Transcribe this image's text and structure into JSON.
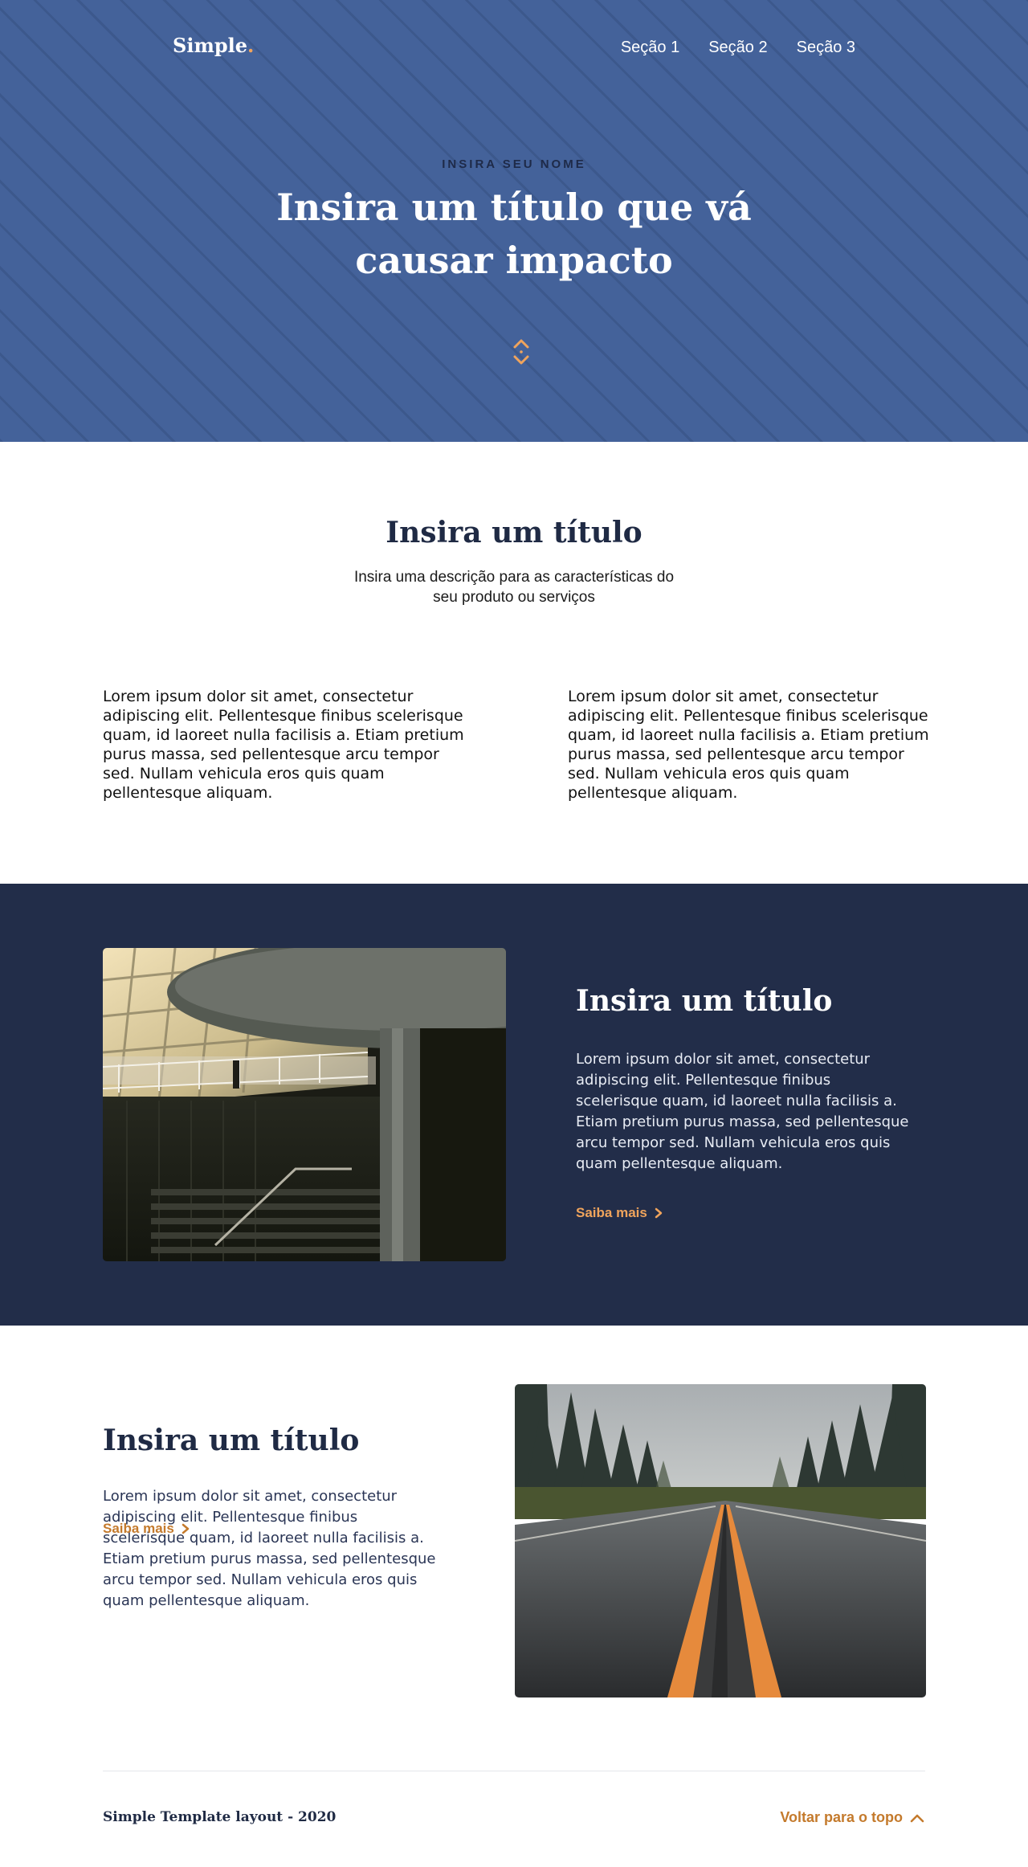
{
  "header": {
    "logo_text": "Simple",
    "logo_dot": ".",
    "nav": [
      {
        "label": "Seção 1"
      },
      {
        "label": "Seção 2"
      },
      {
        "label": "Seção 3"
      }
    ]
  },
  "hero": {
    "eyebrow": "INSIRA SEU NOME",
    "title": "Insira um título que vá causar impacto",
    "scroll_icon": "chevron-up-down-icon"
  },
  "intro": {
    "title": "Insira um título",
    "description": "Insira uma descrição para as características do seu produto ou serviços",
    "columns": [
      {
        "text": "Lorem ipsum dolor sit amet, consectetur adipiscing elit. Pellentesque finibus scelerisque quam, id laoreet nulla facilisis a. Etiam pretium purus massa, sed pellentesque arcu tempor sed. Nullam vehicula eros quis quam pellentesque aliquam."
      },
      {
        "text": "Lorem ipsum dolor sit amet, consectetur adipiscing elit. Pellentesque finibus scelerisque quam, id laoreet nulla facilisis a. Etiam pretium purus massa, sed pellentesque arcu tempor sed. Nullam vehicula eros quis quam pellentesque aliquam."
      }
    ]
  },
  "feature_dark": {
    "title": "Insira um título",
    "body": "Lorem ipsum dolor sit amet, consectetur adipiscing elit. Pellentesque finibus scelerisque quam, id laoreet nulla facilisis a. Etiam pretium purus massa, sed pellentesque arcu tempor sed. Nullam vehicula eros quis quam pellentesque aliquam.",
    "link": "Saiba mais",
    "image": "building-staircase-photo"
  },
  "feature_light": {
    "title": "Insira um título",
    "body": "Lorem ipsum dolor sit amet, consectetur adipiscing elit. Pellentesque finibus scelerisque quam, id laoreet nulla facilisis a. Etiam pretium purus massa, sed pellentesque arcu tempor sed. Nullam vehicula eros quis quam pellentesque aliquam.",
    "link": "Saiba mais",
    "image": "foggy-road-photo"
  },
  "footer": {
    "credit": "Simple Template layout - 2020",
    "back_to_top": "Voltar para o topo"
  },
  "colors": {
    "hero_bg": "#44629a",
    "dark_bg": "#222d49",
    "accent": "#f0a45c",
    "accent_dark": "#c47a2c",
    "navy_text": "#1f2a44"
  }
}
